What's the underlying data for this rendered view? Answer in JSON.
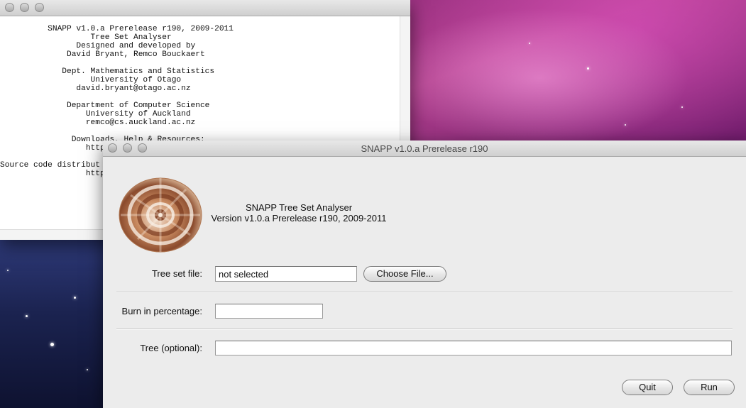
{
  "about_window": {
    "text": "          SNAPP v1.0.a Prerelease r190, 2009-2011\n                   Tree Set Analyser\n                Designed and developed by\n              David Bryant, Remco Bouckaert\n\n             Dept. Mathematics and Statistics\n                   University of Otago\n                david.bryant@otago.ac.nz\n\n              Department of Computer Science\n                  University of Auckland\n                  remco@cs.auckland.ac.nz\n\n               Downloads, Help & Resources:\n                  https:\n\nSource code distribut\n                  http:"
  },
  "dialog": {
    "title": "SNAPP v1.0.a Prerelease r190",
    "heading_line1": "SNAPP Tree Set Analyser",
    "heading_line2": "Version v1.0.a Prerelease r190, 2009-2011",
    "tree_set_file": {
      "label": "Tree set file:",
      "value": "not selected",
      "button": "Choose File..."
    },
    "burn_in": {
      "label": "Burn in percentage:",
      "value": ""
    },
    "tree": {
      "label": "Tree (optional):",
      "value": ""
    },
    "buttons": {
      "quit": "Quit",
      "run": "Run"
    }
  },
  "icons": [
    "traffic-light-close-icon",
    "traffic-light-minimize-icon",
    "traffic-light-zoom-icon",
    "shell-logo-icon"
  ],
  "colors": {
    "window_bg": "#ececec",
    "desktop_top": "#b2418f",
    "desktop_bottom": "#1b2350"
  }
}
